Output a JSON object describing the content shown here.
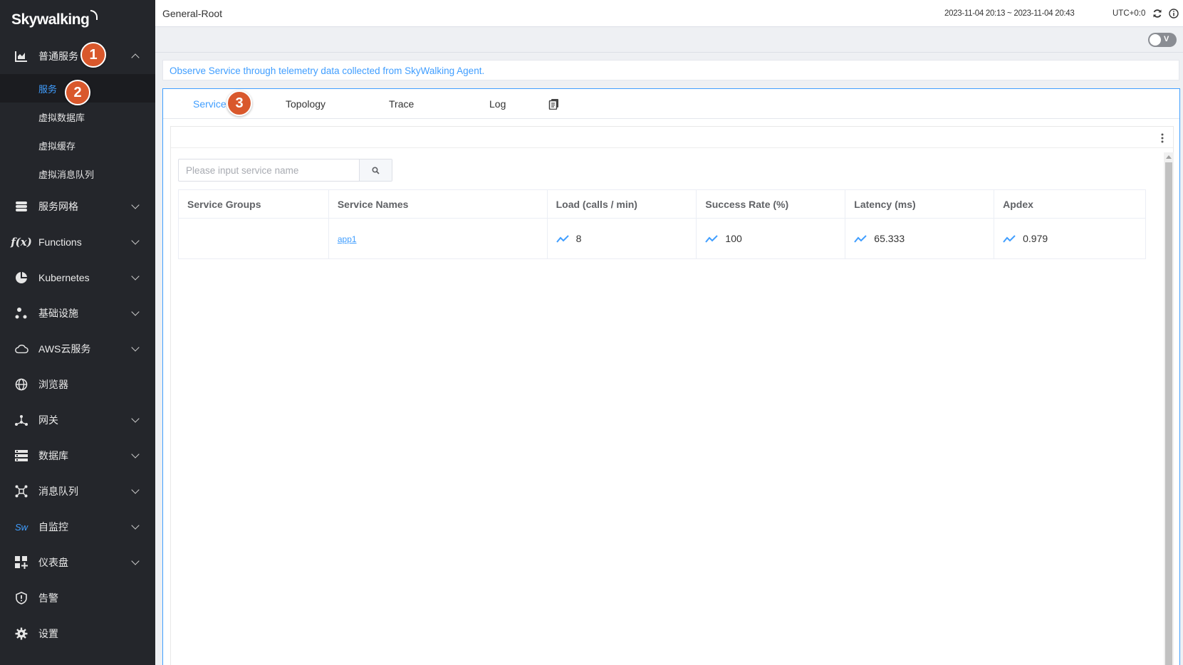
{
  "sidebar": {
    "logo": "Skywalking",
    "items": [
      {
        "label": "普通服务",
        "icon": "chart-icon",
        "expanded": true
      },
      {
        "label": "服务网格",
        "icon": "database-stack-icon"
      },
      {
        "label": "Functions",
        "icon": "function-icon"
      },
      {
        "label": "Kubernetes",
        "icon": "kubernetes-icon"
      },
      {
        "label": "基础设施",
        "icon": "dots-cluster-icon"
      },
      {
        "label": "AWS云服务",
        "icon": "cloud-icon"
      },
      {
        "label": "浏览器",
        "icon": "globe-icon"
      },
      {
        "label": "网关",
        "icon": "gateway-icon"
      },
      {
        "label": "数据库",
        "icon": "list-database-icon"
      },
      {
        "label": "消息队列",
        "icon": "network-nodes-icon"
      },
      {
        "label": "自监控",
        "icon": "sw-icon"
      },
      {
        "label": "仪表盘",
        "icon": "dashboard-grid-icon"
      },
      {
        "label": "告警",
        "icon": "alert-shield-icon"
      },
      {
        "label": "设置",
        "icon": "gear-icon"
      }
    ],
    "sub_items": [
      {
        "label": "服务",
        "active": true
      },
      {
        "label": "虚拟数据库"
      },
      {
        "label": "虚拟缓存"
      },
      {
        "label": "虚拟消息队列"
      }
    ],
    "sw_text": "Sw"
  },
  "annotations": [
    "1",
    "2",
    "3"
  ],
  "header": {
    "title": "General-Root",
    "time_range": "2023-11-04 20:13 ~ 2023-11-04 20:43",
    "timezone": "UTC+0:0"
  },
  "toolbar": {
    "toggle_label": "V"
  },
  "description": "Observe Service through telemetry data collected from SkyWalking Agent.",
  "tabs": [
    {
      "label": "Service",
      "active": true
    },
    {
      "label": "Topology"
    },
    {
      "label": "Trace"
    },
    {
      "label": "Log"
    }
  ],
  "search": {
    "placeholder": "Please input service name",
    "value": ""
  },
  "table": {
    "headers": [
      "Service Groups",
      "Service Names",
      "Load (calls / min)",
      "Success Rate (%)",
      "Latency (ms)",
      "Apdex"
    ],
    "rows": [
      {
        "group": "",
        "name": "app1",
        "load": "8",
        "success_rate": "100",
        "latency": "65.333",
        "apdex": "0.979"
      }
    ]
  },
  "colors": {
    "accent": "#409eff",
    "sidebar_bg": "#24262b",
    "badge": "#d9582c"
  }
}
